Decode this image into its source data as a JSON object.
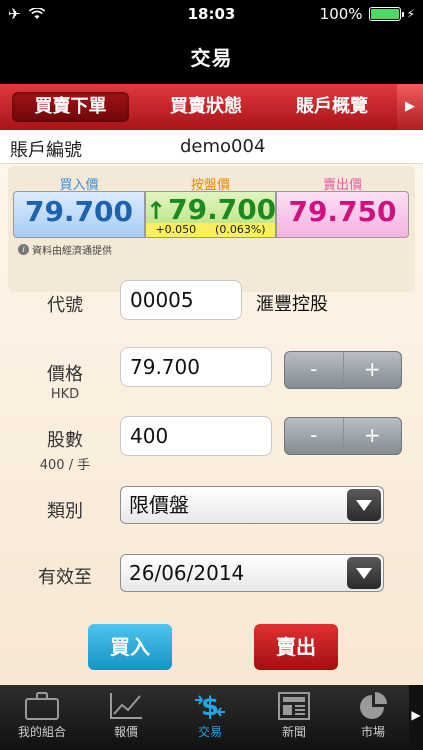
{
  "status": {
    "time": "18:03",
    "battery": "100%"
  },
  "nav": {
    "title": "交易"
  },
  "tabs": [
    {
      "label": "買賣下單",
      "active": true
    },
    {
      "label": "買賣狀態",
      "active": false
    },
    {
      "label": "賬戶概覽",
      "active": false
    }
  ],
  "account": {
    "label": "賬戶編號",
    "value": "demo004"
  },
  "quote": {
    "buy_label": "買入價",
    "buy_price": "79.700",
    "last_label": "按盤價",
    "last_price": "79.700",
    "change": "+0.050",
    "change_pct": "(0.063%)",
    "sell_label": "賣出價",
    "sell_price": "79.750",
    "source_note": "資料由經濟通提供"
  },
  "form": {
    "code_label": "代號",
    "code_value": "00005",
    "stock_name": "滙豐控股",
    "price_label": "價格",
    "price_currency": "HKD",
    "price_value": "79.700",
    "qty_label": "股數",
    "qty_lot": "400 / 手",
    "qty_value": "400",
    "type_label": "類別",
    "type_value": "限價盤",
    "valid_label": "有效至",
    "valid_value": "26/06/2014",
    "minus": "-",
    "plus": "+"
  },
  "actions": {
    "buy": "買入",
    "sell": "賣出"
  },
  "tabbar": [
    {
      "label": "我的組合",
      "icon": "briefcase-icon"
    },
    {
      "label": "報價",
      "icon": "chart-line-icon"
    },
    {
      "label": "交易",
      "icon": "dollar-exchange-icon",
      "active": true
    },
    {
      "label": "新聞",
      "icon": "newspaper-icon"
    },
    {
      "label": "市場",
      "icon": "pie-chart-icon"
    }
  ],
  "colors": {
    "accent_red": "#c4161c",
    "buy_blue": "#1d62ad",
    "last_green": "#1e8a1e",
    "sell_pink": "#d1107f",
    "active_tab": "#22a6e6"
  }
}
